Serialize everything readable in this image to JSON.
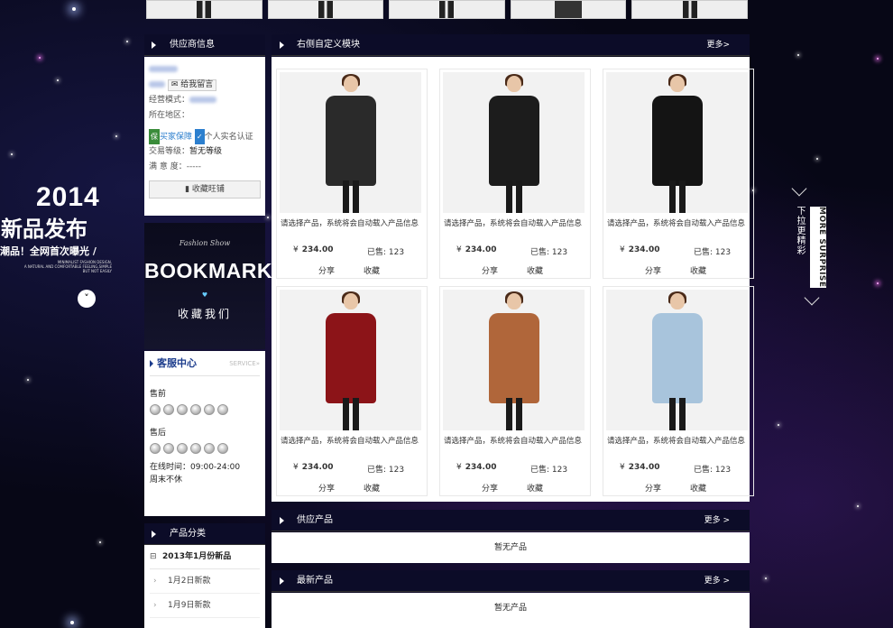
{
  "promo": {
    "year": "2014",
    "title": "新品发布",
    "subtitle": "潮品！全网首次曝光 /",
    "small_text": "MINIMALIST FASHION DESIGN,\nA NATURAL AND COMFORTABLE FEELING,SIMPLE\nBUT NOT EASILY",
    "scroll_icon": "chevron-down-icon"
  },
  "right_side": {
    "more_surprise": "MORE SURPRISE",
    "pull_text": "下拉更精彩"
  },
  "supplier": {
    "header": "供应商信息",
    "message_button": "给我留言",
    "business_mode_label": "经营模式：",
    "location_label": "所在地区：",
    "buyer_protection": "买家保障",
    "real_name": "个人实名认证",
    "trade_level_label": "交易等级：",
    "trade_level_value": "暂无等级",
    "satisfaction_label": "满 意 度：",
    "satisfaction_value": "-----",
    "bookmark_button": "收藏旺铺"
  },
  "bookmark_banner": {
    "script": "Fashion Show",
    "title": "BOOKMARK",
    "subtitle": "收藏我们"
  },
  "service": {
    "title": "客服中心",
    "en": "SERVICE»",
    "presale": "售前",
    "aftersale": "售后",
    "hours": "在线时间：09:00-24:00",
    "weekend": "周末不休"
  },
  "categories": {
    "header": "产品分类",
    "main": "2013年1月份新品",
    "items": [
      "1月2日新款",
      "1月9日新款"
    ]
  },
  "main_module": {
    "header": "右侧自定义模块",
    "more": "更多>"
  },
  "products": [
    {
      "desc": "请选择产品，系统将会自动载入产品信息",
      "currency": "¥",
      "price": "234.00",
      "sold_label": "已售:",
      "sold": "123",
      "share": "分享",
      "fav": "收藏",
      "coat_color": "#2a2a2a"
    },
    {
      "desc": "请选择产品，系统将会自动载入产品信息",
      "currency": "¥",
      "price": "234.00",
      "sold_label": "已售:",
      "sold": "123",
      "share": "分享",
      "fav": "收藏",
      "coat_color": "#1c1c1c"
    },
    {
      "desc": "请选择产品，系统将会自动载入产品信息",
      "currency": "¥",
      "price": "234.00",
      "sold_label": "已售:",
      "sold": "123",
      "share": "分享",
      "fav": "收藏",
      "coat_color": "#141414"
    },
    {
      "desc": "请选择产品，系统将会自动载入产品信息",
      "currency": "¥",
      "price": "234.00",
      "sold_label": "已售:",
      "sold": "123",
      "share": "分享",
      "fav": "收藏",
      "coat_color": "#8c1418"
    },
    {
      "desc": "请选择产品，系统将会自动载入产品信息",
      "currency": "¥",
      "price": "234.00",
      "sold_label": "已售:",
      "sold": "123",
      "share": "分享",
      "fav": "收藏",
      "coat_color": "#b0663a"
    },
    {
      "desc": "请选择产品，系统将会自动载入产品信息",
      "currency": "¥",
      "price": "234.00",
      "sold_label": "已售:",
      "sold": "123",
      "share": "分享",
      "fav": "收藏",
      "coat_color": "#a8c4dc"
    }
  ],
  "supply_products": {
    "header": "供应产品",
    "more": "更多 >",
    "empty": "暂无产品"
  },
  "latest_products": {
    "header": "最新产品",
    "more": "更多 >",
    "empty": "暂无产品"
  }
}
